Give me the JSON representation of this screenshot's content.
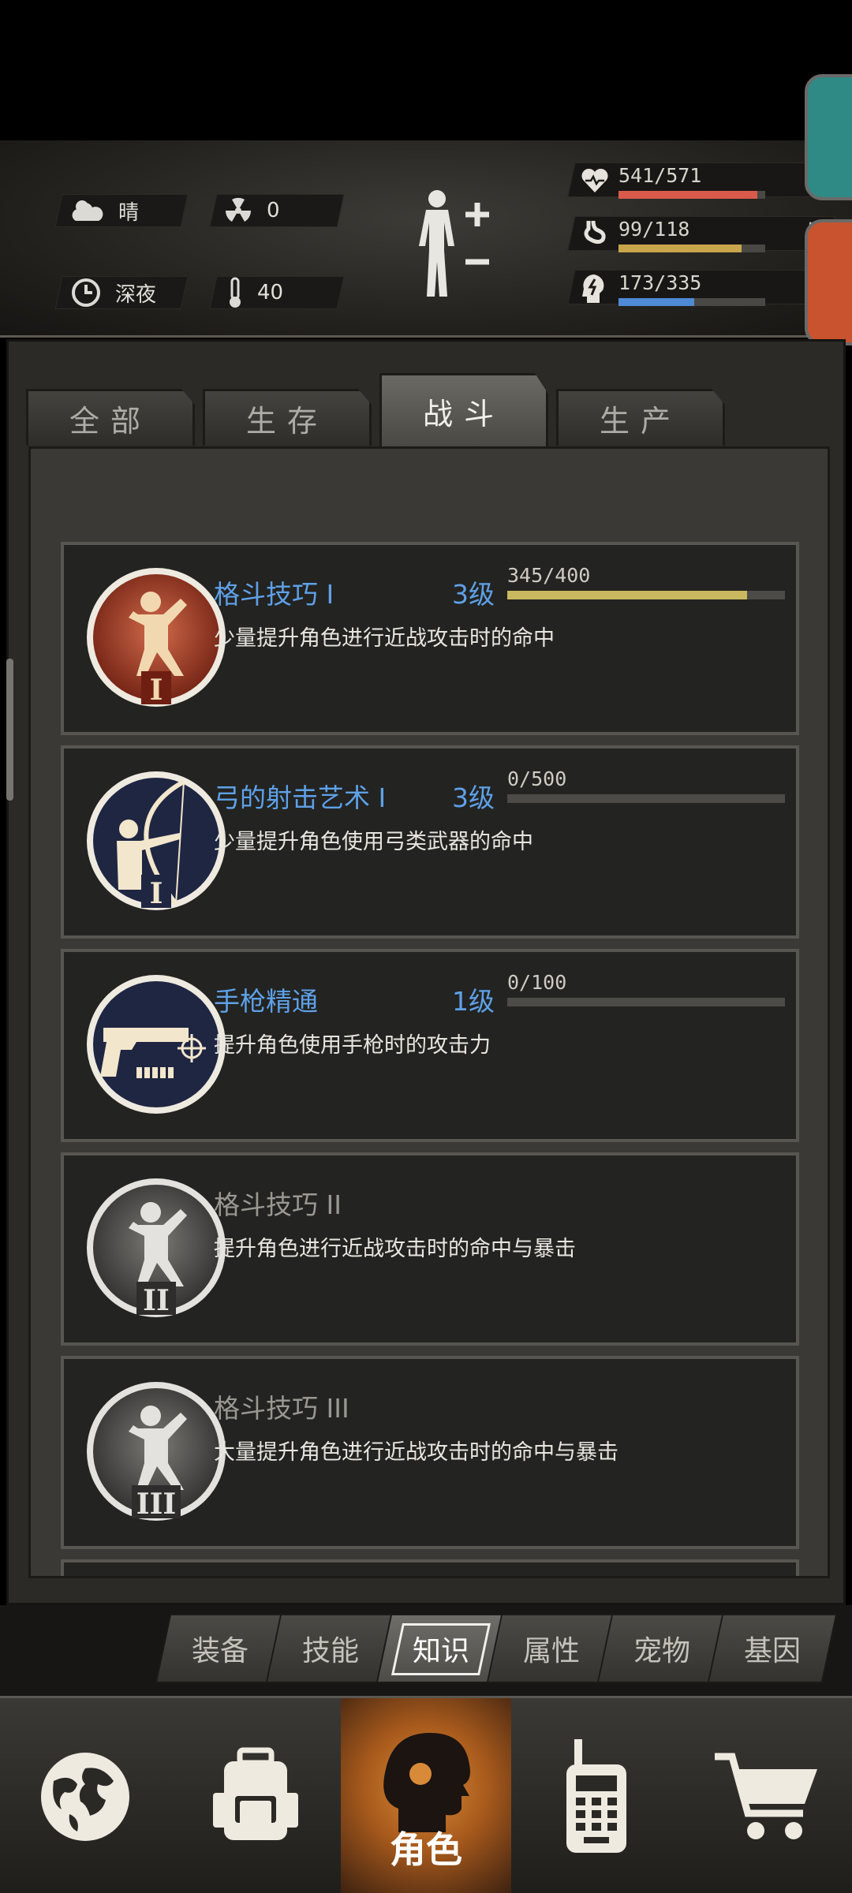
{
  "header": {
    "weather": "晴",
    "radiation": "0",
    "time_of_day": "深夜",
    "temperature": "40",
    "stats": [
      {
        "value": "541/571",
        "label": "生命",
        "fill": 0.947,
        "color": "#d95a4a"
      },
      {
        "value": "99/118",
        "label": "饥饿",
        "fill": 0.839,
        "color": "#c9a64c"
      },
      {
        "value": "173/335",
        "label": "精力",
        "fill": 0.516,
        "color": "#4f8ad4"
      }
    ]
  },
  "tabs": [
    "全部",
    "生存",
    "战斗",
    "生产"
  ],
  "active_tab": "战斗",
  "skills": [
    {
      "title": "格斗技巧 I",
      "level": "3级",
      "desc": "少量提升角色进行近战攻击时的命中",
      "progress": "345/400",
      "fill": 0.8625,
      "locked": false
    },
    {
      "title": "弓的射击艺术 I",
      "level": "3级",
      "desc": "少量提升角色使用弓类武器的命中",
      "progress": "0/500",
      "fill": 0,
      "locked": false
    },
    {
      "title": "手枪精通",
      "level": "1级",
      "desc": "提升角色使用手枪时的攻击力",
      "progress": "0/100",
      "fill": 0,
      "locked": false
    },
    {
      "title": "格斗技巧 II",
      "level": "",
      "desc": "提升角色进行近战攻击时的命中与暴击",
      "progress": "",
      "fill": 0,
      "locked": true
    },
    {
      "title": "格斗技巧 III",
      "level": "",
      "desc": "大量提升角色进行近战攻击时的命中与暴击",
      "progress": "",
      "fill": 0,
      "locked": true
    }
  ],
  "bottom_tabs": [
    "装备",
    "技能",
    "知识",
    "属性",
    "宠物",
    "基因"
  ],
  "active_bottom_tab": "知识",
  "nav": {
    "active_label": "角色",
    "icons": [
      "globe-icon",
      "backpack-icon",
      "character-head-icon",
      "walkie-talkie-icon",
      "shopping-cart-icon"
    ]
  }
}
